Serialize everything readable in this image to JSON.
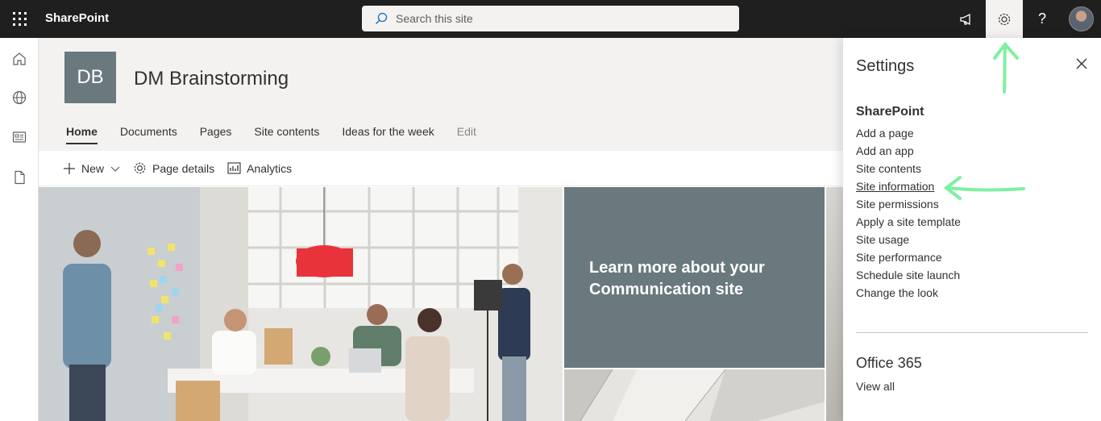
{
  "suitebar": {
    "app_name": "SharePoint",
    "search_placeholder": "Search this site",
    "icons": [
      "waffle-icon",
      "megaphone-icon",
      "gear-icon",
      "help-icon",
      "avatar"
    ],
    "help_glyph": "?"
  },
  "leftrail": {
    "icons": [
      "home-icon",
      "globe-icon",
      "news-icon",
      "document-icon"
    ]
  },
  "site": {
    "logo_initials": "DB",
    "title": "DM Brainstorming",
    "nav": [
      {
        "label": "Home",
        "active": true
      },
      {
        "label": "Documents"
      },
      {
        "label": "Pages"
      },
      {
        "label": "Site contents"
      },
      {
        "label": "Ideas for the week"
      },
      {
        "label": "Edit",
        "muted": true
      }
    ]
  },
  "commandbar": {
    "new_label": "New",
    "page_details_label": "Page details",
    "analytics_label": "Analytics"
  },
  "hero": {
    "tile_text": "Learn more about your Communication site",
    "tile_color": "#69797e"
  },
  "settings": {
    "title": "Settings",
    "section_title": "SharePoint",
    "links": [
      "Add a page",
      "Add an app",
      "Site contents",
      "Site information",
      "Site permissions",
      "Apply a site template",
      "Site usage",
      "Site performance",
      "Schedule site launch",
      "Change the look"
    ],
    "highlighted_link": "Site information",
    "section2_title": "Office 365",
    "view_all": "View all"
  },
  "annotation_color": "#7ef0a0"
}
